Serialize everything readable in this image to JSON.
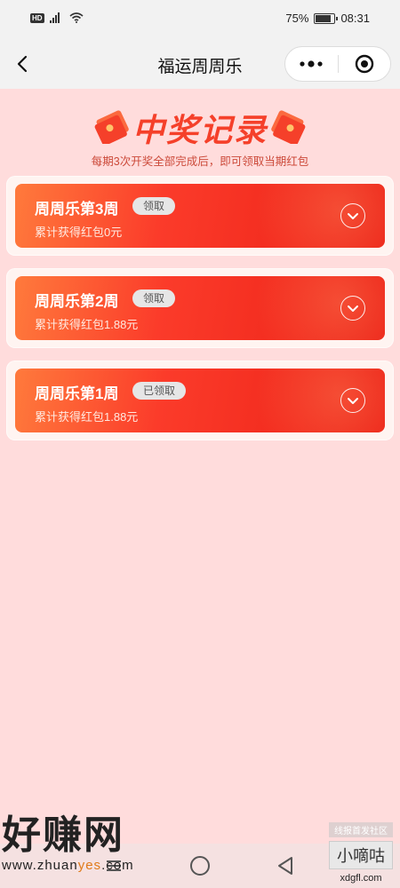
{
  "status_bar": {
    "hd": "HD",
    "battery": "75%",
    "time": "08:31",
    "battery_level": 0.75
  },
  "nav": {
    "title": "福运周周乐",
    "back_icon": "chevron-left-icon",
    "menu_icon": "more-dots-icon",
    "close_icon": "target-close-icon"
  },
  "header": {
    "title": "中奖记录",
    "subtitle": "每期3次开奖全部完成后，即可领取当期红包"
  },
  "records": [
    {
      "title": "周周乐第3周",
      "badge": "领取",
      "amount": "累计获得红包0元"
    },
    {
      "title": "周周乐第2周",
      "badge": "领取",
      "amount": "累计获得红包1.88元"
    },
    {
      "title": "周周乐第1周",
      "badge": "已领取",
      "amount": "累计获得红包1.88元"
    }
  ],
  "watermark": {
    "left_big": "好赚网",
    "left_url_a": "www.zhuan",
    "left_url_yes": "yes",
    "left_url_b": ".com",
    "right_top": "线报首发社区",
    "right_mid": "小嘀咕",
    "right_bottom": "xdgfl.com"
  },
  "colors": {
    "page_bg": "#ffdcdc",
    "card_red": "#f5402a",
    "title_red": "#f5402a"
  }
}
